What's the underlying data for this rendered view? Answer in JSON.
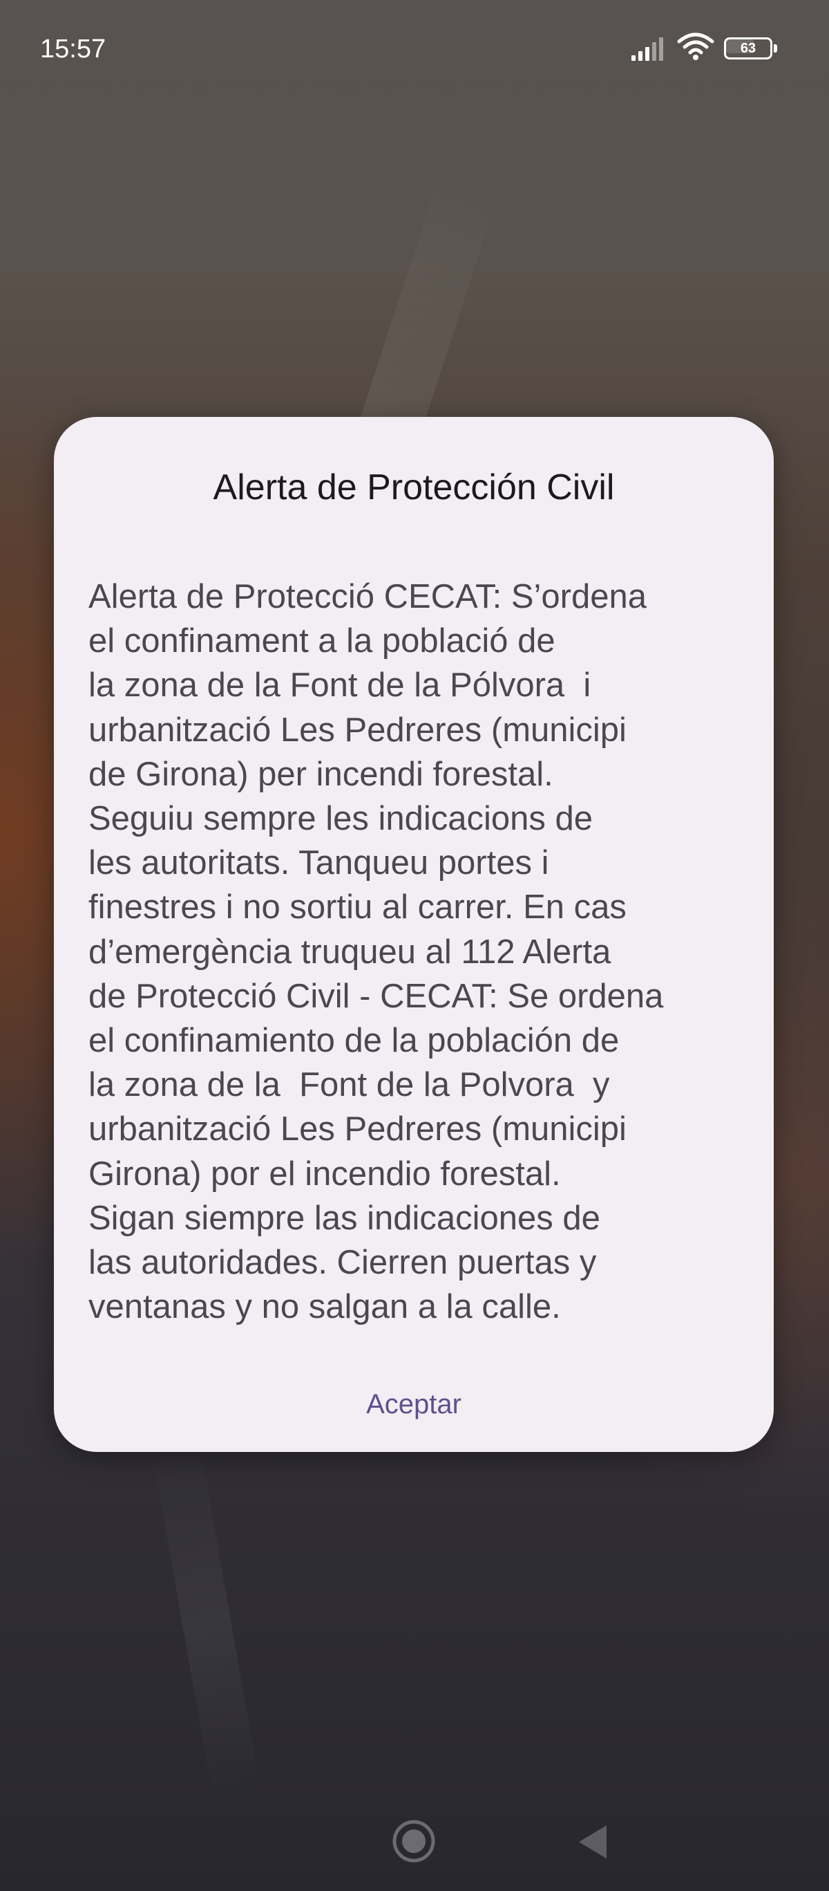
{
  "status_bar": {
    "time": "15:57",
    "battery_level": "63",
    "signal_icon": "cellular-signal-icon",
    "wifi_icon": "wifi-icon",
    "battery_icon": "battery-icon"
  },
  "dialog": {
    "title": "Alerta de Protección Civil",
    "body_lines": [
      "Alerta de Protecció CECAT: S’ordena",
      "el confinament a la població de",
      "la zona de la Font de la Pólvora  i",
      "urbanització Les Pedreres (municipi",
      "de Girona) per incendi forestal.",
      "Seguiu sempre les indicacions de",
      "les autoritats. Tanqueu portes i",
      "finestres i no sortiu al carrer. En cas",
      "d’emergència truqueu al 112 Alerta",
      "de Protecció Civil - CECAT: Se ordena",
      "el confinamiento de la población de",
      "la zona de la  Font de la Polvora  y",
      "urbanització Les Pedreres (municipi",
      "Girona) por el incendio forestal.",
      "Sigan siempre las indicaciones de",
      "las autoridades. Cierren puertas y",
      "ventanas y no salgan a la calle."
    ],
    "accept_label": "Aceptar",
    "accent_color": "#5f4f8e"
  },
  "nav_bar": {
    "home_icon": "home-circle-icon",
    "back_icon": "back-triangle-icon"
  }
}
